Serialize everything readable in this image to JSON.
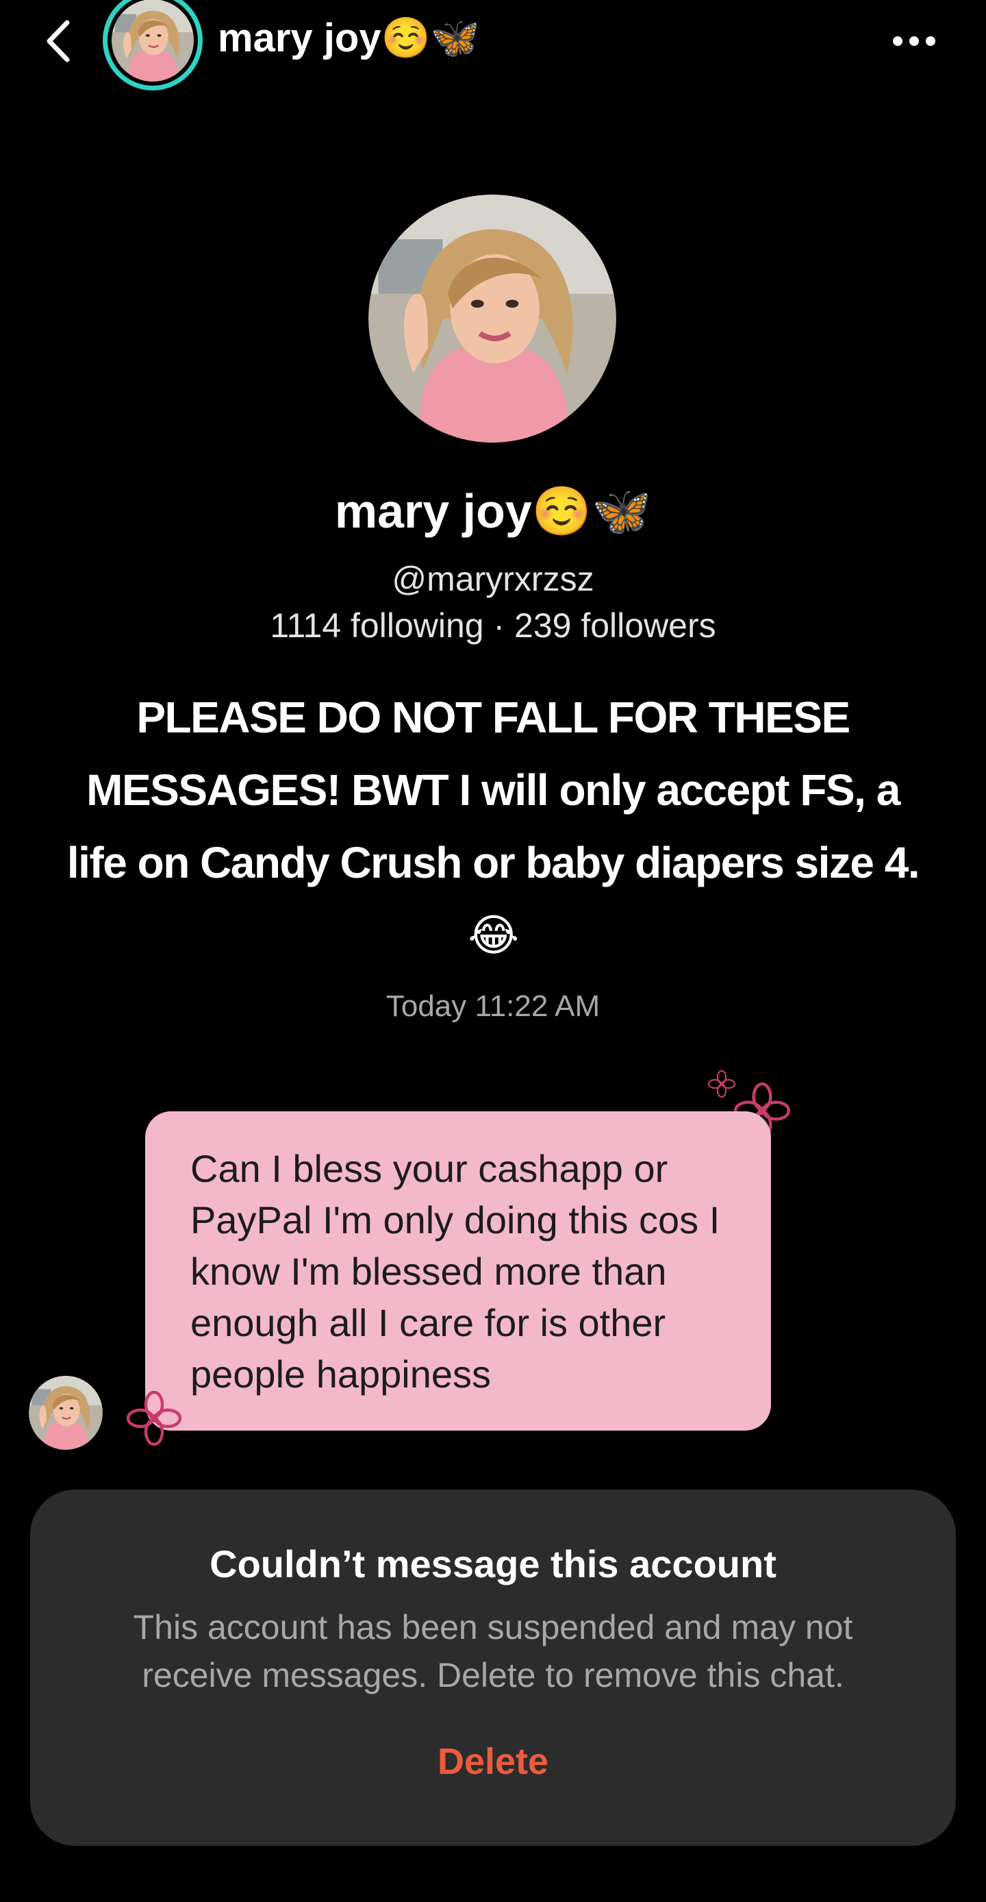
{
  "header": {
    "name": "mary joy☺️🦋",
    "back_icon": "chevron-left-icon",
    "more_icon": "ellipsis-icon",
    "ring_color": "#2ed3c4"
  },
  "profile": {
    "name": "mary joy☺️🦋",
    "handle": "@maryrxrzsz",
    "stats": "1114 following · 239 followers",
    "bio": "PLEASE DO NOT FALL FOR THESE MESSAGES! BWT I will only accept FS,  a life on Candy Crush or baby diapers size 4. 😂"
  },
  "chat": {
    "timestamp": "Today 11:22 AM",
    "message": "Can I bless your cashapp or PayPal I'm only doing this cos I know I'm blessed more than enough all I care for is other people happiness",
    "bubble_color": "#f4b8cb",
    "decoration_icon": "flower-icon"
  },
  "notice": {
    "title": "Couldn’t message this account",
    "body": "This account has been suspended and may not receive messages. Delete to remove this chat.",
    "delete_label": "Delete",
    "delete_color": "#ec5c3d"
  }
}
